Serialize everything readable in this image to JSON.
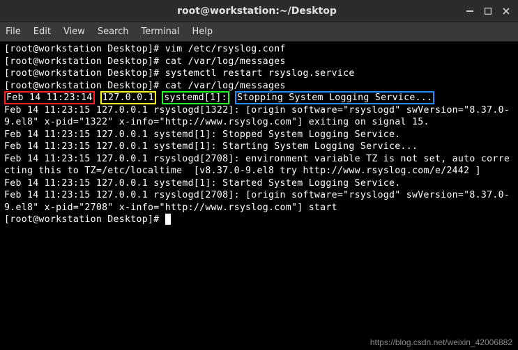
{
  "window": {
    "title": "root@workstation:~/Desktop"
  },
  "menu": {
    "file": "File",
    "edit": "Edit",
    "view": "View",
    "search": "Search",
    "terminal": "Terminal",
    "help": "Help"
  },
  "terminal": {
    "prompt": "[root@workstation Desktop]# ",
    "cmd1": "vim /etc/rsyslog.conf",
    "cmd2": "cat /var/log/messages",
    "cmd3": "systemctl restart rsyslog.service",
    "cmd4": "cat /var/log/messages",
    "hl": {
      "ts": "Feb 14 11:23:14",
      "host": "127.0.0.1",
      "proc": "systemd[1]:",
      "msg": "Stopping System Logging Service..."
    },
    "line2": "Feb 14 11:23:15 127.0.0.1 rsyslogd[1322]: [origin software=\"rsyslogd\" swVersion=\"8.37.0-9.el8\" x-pid=\"1322\" x-info=\"http://www.rsyslog.com\"] exiting on signal 15.",
    "line3": "Feb 14 11:23:15 127.0.0.1 systemd[1]: Stopped System Logging Service.",
    "line4": "Feb 14 11:23:15 127.0.0.1 systemd[1]: Starting System Logging Service...",
    "line5": "Feb 14 11:23:15 127.0.0.1 rsyslogd[2708]: environment variable TZ is not set, auto correcting this to TZ=/etc/localtime  [v8.37.0-9.el8 try http://www.rsyslog.com/e/2442 ]",
    "line6": "Feb 14 11:23:15 127.0.0.1 systemd[1]: Started System Logging Service.",
    "line7": "Feb 14 11:23:15 127.0.0.1 rsyslogd[2708]: [origin software=\"rsyslogd\" swVersion=\"8.37.0-9.el8\" x-pid=\"2708\" x-info=\"http://www.rsyslog.com\"] start"
  },
  "watermark": "https://blog.csdn.net/weixin_42006882"
}
